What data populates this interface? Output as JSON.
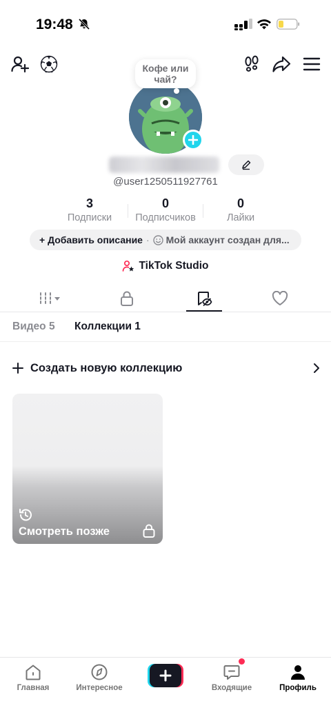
{
  "status_bar": {
    "time": "19:48"
  },
  "header": {
    "add_friend_icon": "person-plus-icon",
    "ball_icon": "soccer-ball-icon",
    "footprints_icon": "footprints-icon",
    "share_icon": "share-arrow-icon",
    "menu_icon": "hamburger-menu-icon"
  },
  "profile": {
    "bubble_text_line1": "Кофе или",
    "bubble_text_line2": "чай?",
    "username": "@user1250511927761",
    "stats": [
      {
        "value": "3",
        "label": "Подписки"
      },
      {
        "value": "0",
        "label": "Подписчиков"
      },
      {
        "value": "0",
        "label": "Лайки"
      }
    ],
    "add_description": "+ Добавить описание",
    "description_placeholder": "Мой аккаунт создан для...",
    "studio_label": "TikTok Studio"
  },
  "subtabs": {
    "videos": "Видео 5",
    "collections": "Коллекции 1"
  },
  "collections": {
    "create_label": "Создать новую коллекцию",
    "items": [
      {
        "title": "Смотреть позже"
      }
    ]
  },
  "bottom_nav": {
    "home": "Главная",
    "discover": "Интересное",
    "inbox": "Входящие",
    "profile": "Профиль"
  },
  "colors": {
    "accent_cyan": "#20d5ec",
    "accent_red": "#fe2c55",
    "text_primary": "#161823",
    "text_secondary": "#8a8b91"
  }
}
